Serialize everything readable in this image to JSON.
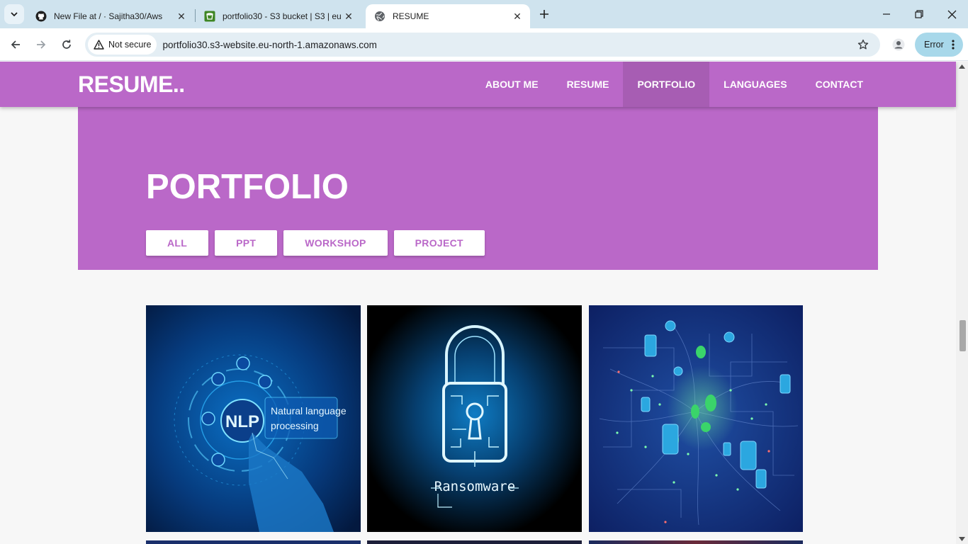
{
  "browser": {
    "tabs": [
      {
        "title": "New File at / · Sajitha30/Aws",
        "icon": "github-icon"
      },
      {
        "title": "portfolio30 - S3 bucket | S3 | eu",
        "icon": "aws-s3-icon"
      },
      {
        "title": "RESUME",
        "icon": "globe-icon"
      }
    ],
    "security_label": "Not secure",
    "url": "portfolio30.s3-website.eu-north-1.amazonaws.com",
    "profile_status": "Error"
  },
  "site": {
    "brand": "RESUME..",
    "nav": [
      {
        "label": "ABOUT ME"
      },
      {
        "label": "RESUME"
      },
      {
        "label": "PORTFOLIO",
        "active": true
      },
      {
        "label": "LANGUAGES"
      },
      {
        "label": "CONTACT"
      }
    ],
    "accent_color": "#ba68c8"
  },
  "portfolio": {
    "title": "PORTFOLIO",
    "filters": [
      {
        "label": "ALL"
      },
      {
        "label": "PPT"
      },
      {
        "label": "WORKSHOP"
      },
      {
        "label": "PROJECT"
      }
    ],
    "items": [
      {
        "image": "nlp-natural-language-processing-image",
        "caption_lines": [
          "NLP",
          "Natural language",
          "processing"
        ]
      },
      {
        "image": "ransomware-lock-image",
        "caption_lines": [
          "Ransomware"
        ]
      },
      {
        "image": "circuit-network-social-icons-image",
        "caption_lines": []
      }
    ]
  }
}
